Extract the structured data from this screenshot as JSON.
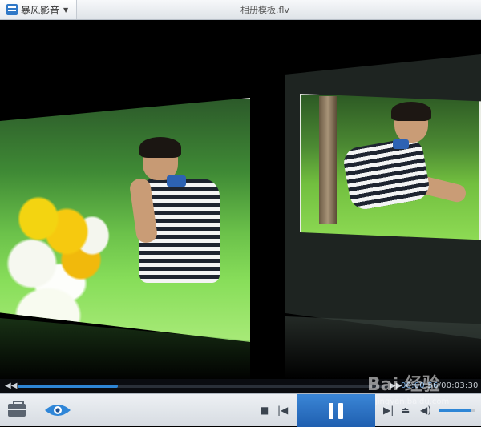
{
  "titlebar": {
    "app_name": "暴风影音",
    "file_title": "相册模板.flv"
  },
  "player": {
    "current_time": "00:00:56",
    "total_time": "00:03:30",
    "time_separator": "/",
    "progress": 0.27,
    "volume": 0.9
  },
  "controls": {
    "toolbox_icon": "toolbox-icon",
    "eye_icon": "eye-icon",
    "stop_icon": "stop-icon",
    "prev_icon": "previous-icon",
    "pause_icon": "pause-icon",
    "next_icon": "next-icon",
    "eject_icon": "eject-icon",
    "volume_icon": "volume-icon"
  },
  "watermark": {
    "text": "Bai 经验",
    "sub": "jingyan.baidu.com"
  },
  "colors": {
    "accent": "#2e86d6",
    "play_zone": "#2a73c5"
  }
}
